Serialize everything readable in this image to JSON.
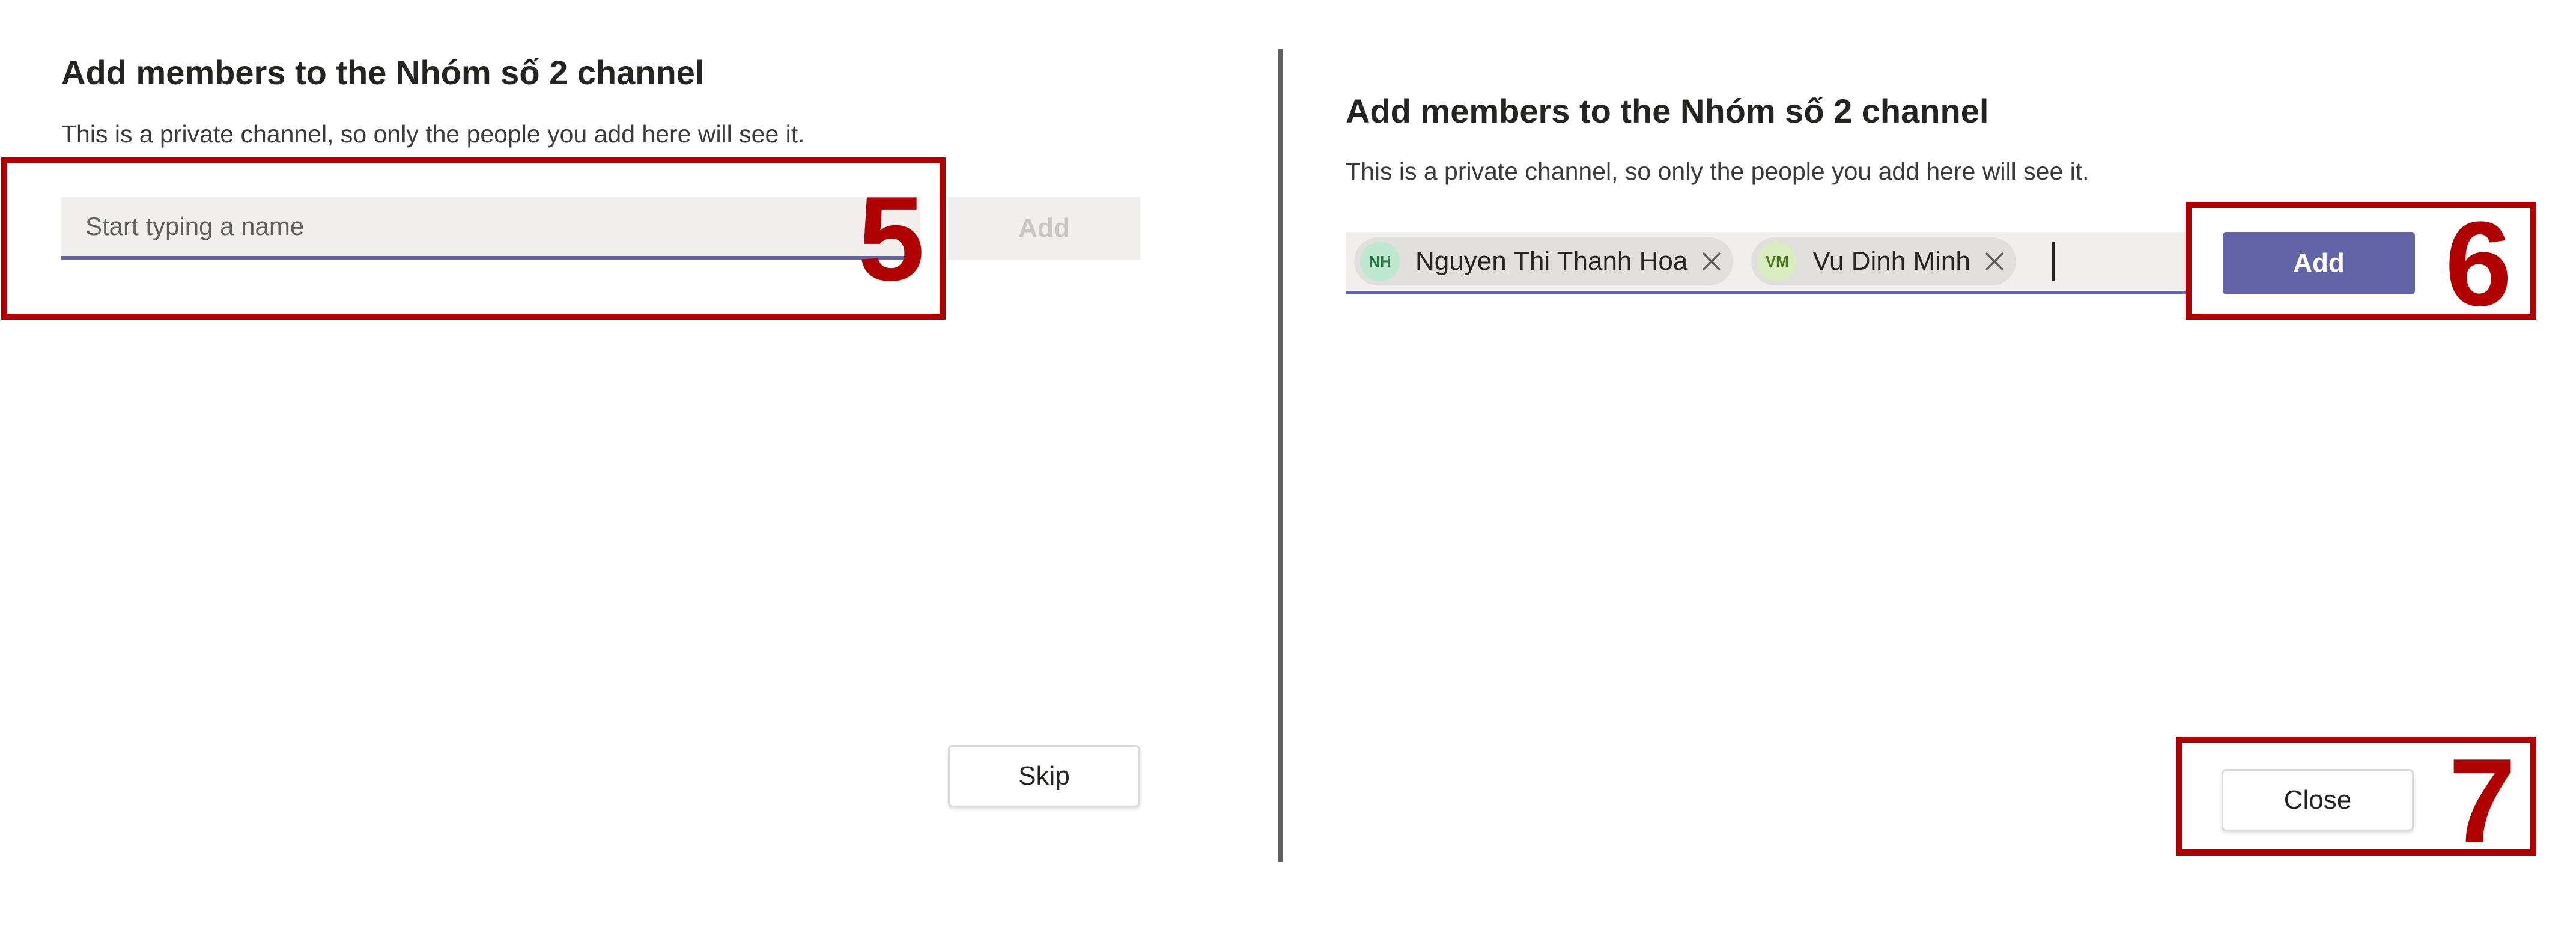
{
  "left_dialog": {
    "title": "Add members to the Nhóm số 2 channel",
    "subtitle": "This is a private channel, so only the people you add here will see it.",
    "search_placeholder": "Start typing a name",
    "add_label": "Add",
    "skip_label": "Skip"
  },
  "right_dialog": {
    "title": "Add members to the Nhóm số 2 channel",
    "subtitle": "This is a private channel, so only the people you add here will see it.",
    "selected_people": [
      {
        "initials": "NH",
        "name": "Nguyen Thi Thanh Hoa"
      },
      {
        "initials": "VM",
        "name": "Vu Dinh Minh"
      }
    ],
    "add_label": "Add",
    "close_label": "Close"
  },
  "annotations": [
    "5",
    "6",
    "7"
  ],
  "colors": {
    "accent": "#6264a7",
    "annotation": "#b00000",
    "input_bg": "#f0efee",
    "divider": "#616161"
  },
  "icons": {
    "remove_person": "close-x-icon"
  }
}
